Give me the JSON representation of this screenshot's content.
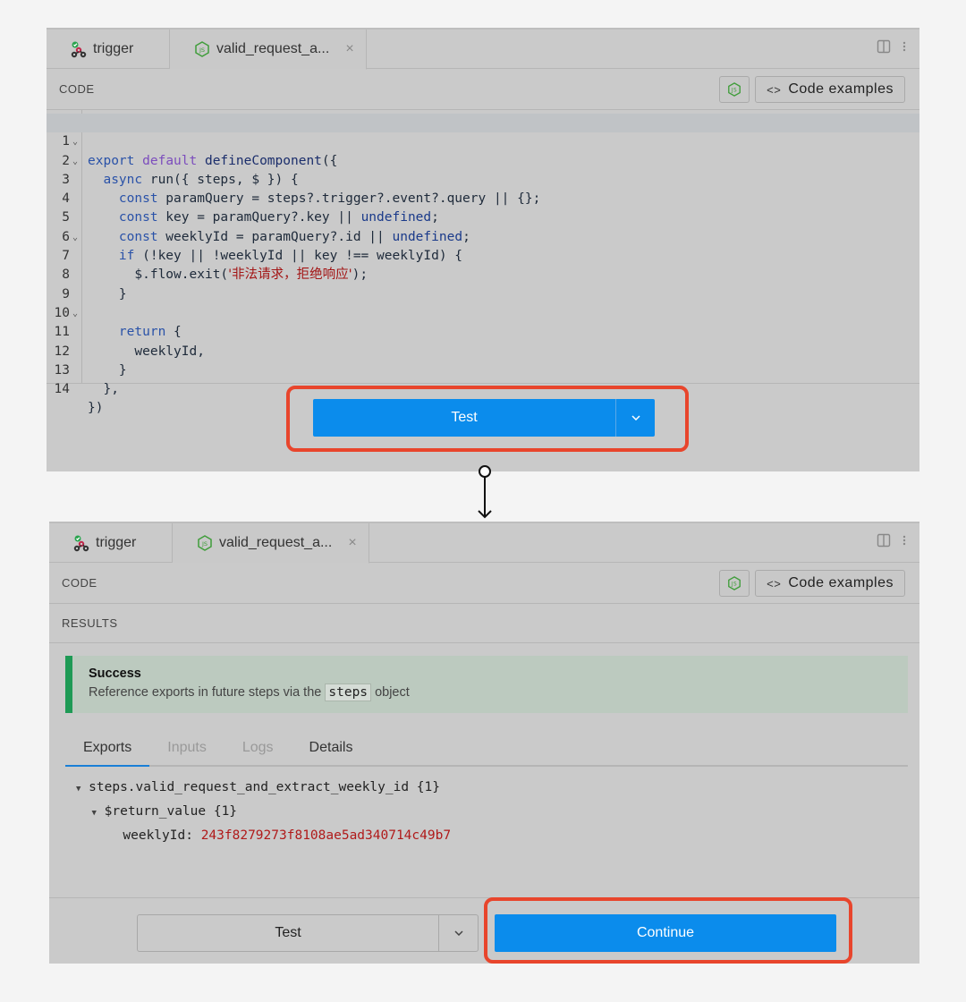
{
  "tabs": [
    {
      "label": "trigger",
      "icon": "webhook-icon"
    },
    {
      "label": "valid_request_a...",
      "icon": "nodejs-icon",
      "close": "×"
    }
  ],
  "code_section": {
    "label": "CODE",
    "examples_label": "Code examples",
    "examples_glyph": "<>"
  },
  "results_section": {
    "label": "RESULTS"
  },
  "code_lines": [
    {
      "n": "1"
    },
    {
      "n": "2"
    },
    {
      "n": "3"
    },
    {
      "n": "4"
    },
    {
      "n": "5"
    },
    {
      "n": "6"
    },
    {
      "n": "7"
    },
    {
      "n": "8"
    },
    {
      "n": "9"
    },
    {
      "n": "10"
    },
    {
      "n": "11"
    },
    {
      "n": "12"
    },
    {
      "n": "13"
    },
    {
      "n": "14"
    }
  ],
  "code": {
    "l1_a": "export",
    "l1_b": "default",
    "l1_c": "defineComponent",
    "l1_d": "({",
    "l2_a": "async",
    "l2_b": " run({ steps, $ }) {",
    "l3_a": "const",
    "l3_b": " paramQuery = steps?.trigger?.event?.query || {};",
    "l4_a": "const",
    "l4_b": " key = paramQuery?.key || ",
    "l4_c": "undefined",
    "l4_d": ";",
    "l5_a": "const",
    "l5_b": " weeklyId = paramQuery?.id || ",
    "l5_c": "undefined",
    "l5_d": ";",
    "l6_a": "if",
    "l6_b": " (!key || !weeklyId || key !== weeklyId) {",
    "l7_a": "$.flow.exit(",
    "l7_b": "'非法请求，拒绝响应'",
    "l7_c": ");",
    "l8": "}",
    "l10_a": "return",
    "l10_b": " {",
    "l11": "weeklyId,",
    "l12": "}",
    "l13": "},",
    "l14": "})"
  },
  "buttons": {
    "test": "Test",
    "continue": "Continue",
    "caret": "⌄"
  },
  "success": {
    "title": "Success",
    "desc_before": "Reference exports in future steps via the",
    "desc_code": "steps",
    "desc_after": "object"
  },
  "result_tabs": [
    "Exports",
    "Inputs",
    "Logs",
    "Details"
  ],
  "exports_tree": {
    "root": "steps.valid_request_and_extract_weekly_id {1}",
    "child": "$return_value {1}",
    "leaf_key": "weeklyId:",
    "leaf_value": "243f8279273f8108ae5ad340714c49b7"
  },
  "colors": {
    "primary": "#0b8cec",
    "highlight": "#e8452c",
    "success": "#1e9a55"
  }
}
